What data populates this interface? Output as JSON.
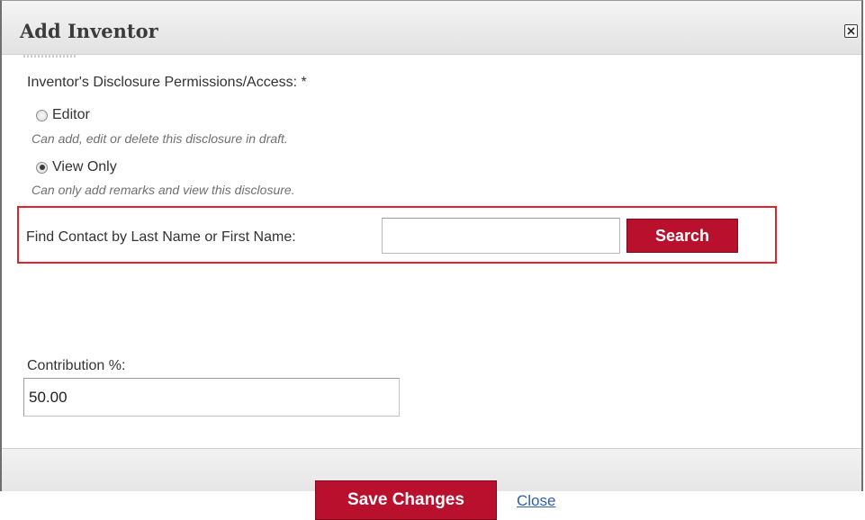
{
  "dialog": {
    "title": "Add Inventor",
    "close_icon": "close-box-icon"
  },
  "permissions": {
    "label": "Inventor's Disclosure Permissions/Access: *",
    "options": [
      {
        "label": "Editor",
        "description": "Can add, edit or delete this disclosure in draft.",
        "checked": false
      },
      {
        "label": "View Only",
        "description": "Can only add remarks and view this disclosure.",
        "checked": true
      }
    ]
  },
  "find_contact": {
    "label": "Find Contact by Last Name or First Name:",
    "value": "",
    "search_label": "Search",
    "highlight_color": "#e0222a"
  },
  "contribution": {
    "label": "Contribution %:",
    "value": "50.00"
  },
  "footer": {
    "save_label": "Save Changes",
    "close_label": "Close"
  },
  "colors": {
    "button_red": "#b9112d",
    "link_blue": "#2f5fa8"
  }
}
